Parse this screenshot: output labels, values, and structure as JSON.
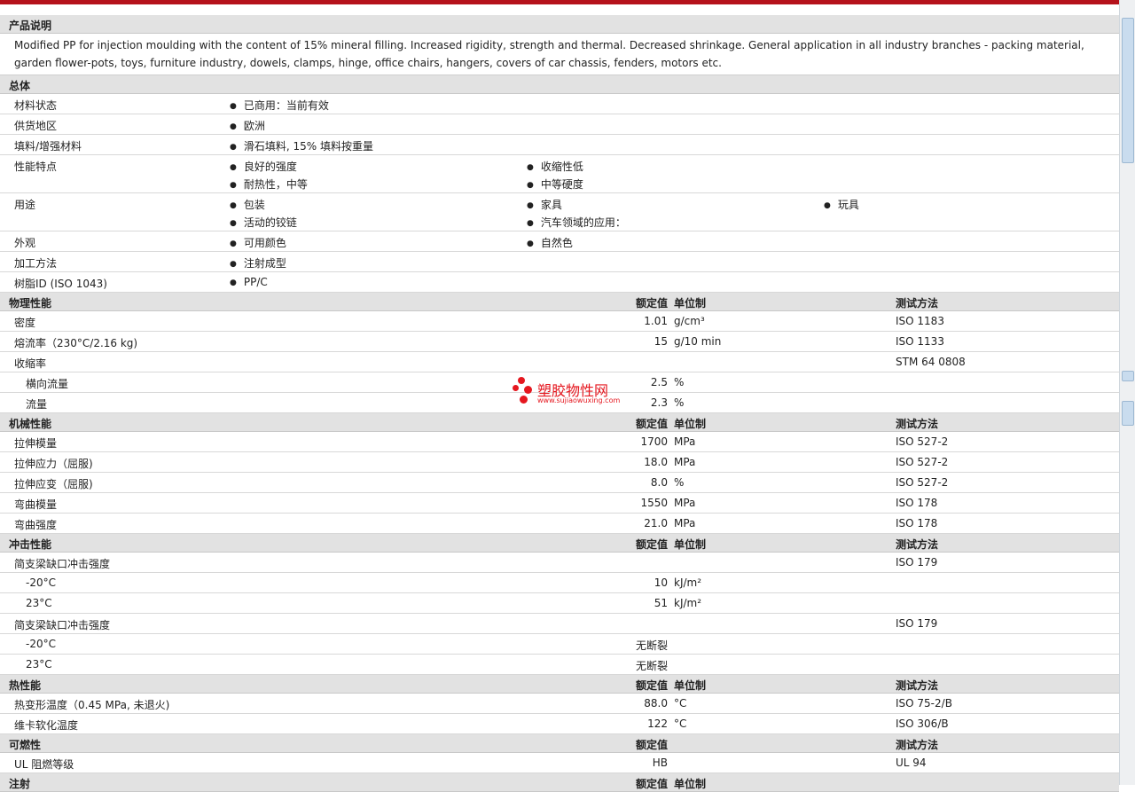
{
  "colors": {
    "accent": "#b5121b",
    "section_bg": "#e2e2e2",
    "logo": "#e5171f"
  },
  "product_description": {
    "title": "产品说明",
    "text": "Modified PP for injection moulding with the content of 15% mineral filling. Increased rigidity, strength and thermal. Decreased shrinkage. General application in all industry branches - packing material, garden flower-pots, toys, furniture industry, dowels, clamps, hinge, office chairs, hangers, covers of car chassis, fenders, motors etc."
  },
  "general": {
    "title": "总体",
    "rows": [
      {
        "label": "材料状态",
        "items": [
          "已商用：当前有效"
        ]
      },
      {
        "label": "供货地区",
        "items": [
          "欧洲"
        ]
      },
      {
        "label": "填料/增强材料",
        "items": [
          "滑石填料, 15% 填料按重量"
        ]
      },
      {
        "label": "性能特点",
        "items": [
          "良好的强度",
          "收缩性低",
          "耐热性，中等",
          "中等硬度"
        ]
      },
      {
        "label": "用途",
        "items": [
          "包装",
          "家具",
          "玩具",
          "活动的铰链",
          "汽车领域的应用："
        ]
      },
      {
        "label": "外观",
        "items": [
          "可用颜色",
          "自然色"
        ]
      },
      {
        "label": "加工方法",
        "items": [
          "注射成型"
        ]
      },
      {
        "label": "树脂ID (ISO 1043)",
        "items": [
          "PP/C"
        ]
      }
    ]
  },
  "headers": {
    "nominal": "额定值",
    "unit": "单位制",
    "method": "测试方法"
  },
  "physical": {
    "title": "物理性能",
    "rows": [
      {
        "label": "密度",
        "value": "1.01",
        "unit": "g/cm³",
        "method": "ISO 1183"
      },
      {
        "label": "熔流率（230°C/2.16 kg)",
        "value": "15",
        "unit": "g/10 min",
        "method": "ISO 1133"
      },
      {
        "label": "收缩率",
        "value": "",
        "unit": "",
        "method": "STM 64 0808"
      },
      {
        "label": "横向流量",
        "value": "2.5",
        "unit": "%",
        "method": ""
      },
      {
        "label": "流量",
        "value": "2.3",
        "unit": "%",
        "method": ""
      }
    ]
  },
  "mechanical": {
    "title": "机械性能",
    "rows": [
      {
        "label": "拉伸模量",
        "value": "1700",
        "unit": "MPa",
        "method": "ISO 527-2"
      },
      {
        "label": "拉伸应力（屈服)",
        "value": "18.0",
        "unit": "MPa",
        "method": "ISO 527-2"
      },
      {
        "label": "拉伸应变（屈服)",
        "value": "8.0",
        "unit": "%",
        "method": "ISO 527-2"
      },
      {
        "label": "弯曲模量",
        "value": "1550",
        "unit": "MPa",
        "method": "ISO 178"
      },
      {
        "label": "弯曲强度",
        "value": "21.0",
        "unit": "MPa",
        "method": "ISO 178"
      }
    ]
  },
  "impact": {
    "title": "冲击性能",
    "rows": [
      {
        "label": "简支梁缺口冲击强度",
        "value": "",
        "unit": "",
        "method": "ISO 179"
      },
      {
        "label": "-20°C",
        "value": "10",
        "unit": "kJ/m²",
        "method": ""
      },
      {
        "label": "23°C",
        "value": "51",
        "unit": "kJ/m²",
        "method": ""
      },
      {
        "label": "简支梁缺口冲击强度",
        "value": "",
        "unit": "",
        "method": "ISO 179"
      },
      {
        "label": "-20°C",
        "value": "无断裂",
        "unit": "",
        "method": ""
      },
      {
        "label": "23°C",
        "value": "无断裂",
        "unit": "",
        "method": ""
      }
    ]
  },
  "thermal": {
    "title": "热性能",
    "rows": [
      {
        "label": "热变形温度（0.45 MPa, 未退火)",
        "value": "88.0",
        "unit": "°C",
        "method": "ISO 75-2/B"
      },
      {
        "label": "维卡软化温度",
        "value": "122",
        "unit": "°C",
        "method": "ISO 306/B"
      }
    ]
  },
  "flammability": {
    "title": "可燃性",
    "rows": [
      {
        "label": "UL 阻燃等级",
        "value": "HB",
        "unit": "",
        "method": "UL 94"
      }
    ]
  },
  "injection": {
    "title": "注射"
  },
  "watermark": {
    "name": "塑胶物性网",
    "url": "www.sujiaowuxing.com"
  }
}
